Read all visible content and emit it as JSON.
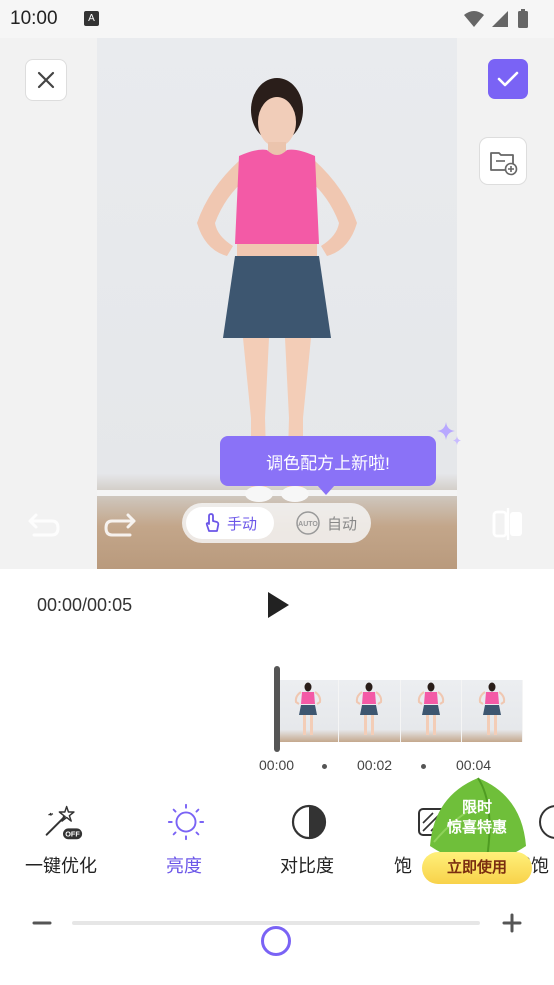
{
  "status_bar": {
    "time": "10:00",
    "notif_glyph": "A",
    "icons": [
      "wifi-icon",
      "signal-icon",
      "battery-icon"
    ]
  },
  "header": {
    "close_icon": "close-icon",
    "confirm_icon": "check-icon",
    "save_icon": "folder-add-icon"
  },
  "preview": {
    "tooltip": "调色配方上新啦!"
  },
  "mode_toggle": {
    "manual_label": "手动",
    "auto_label": "自动",
    "auto_badge": "AUTO",
    "selected": "manual"
  },
  "playback": {
    "timecode": "00:00/00:05"
  },
  "timeline": {
    "ticks": [
      "00:00",
      "00:02",
      "00:04"
    ],
    "frame_count": 4
  },
  "tools": [
    {
      "label": "一键优化",
      "icon": "magic-wand-off-icon",
      "active": false
    },
    {
      "label": "亮度",
      "icon": "brightness-icon",
      "active": true
    },
    {
      "label": "对比度",
      "icon": "contrast-icon",
      "active": false
    },
    {
      "label": "饱",
      "icon": "saturation-icon",
      "active": false
    },
    {
      "label": "然饱",
      "icon": "natural-saturation-icon",
      "active": false
    }
  ],
  "promo": {
    "line1": "限时",
    "line2": "惊喜特惠",
    "button": "立即使用"
  },
  "slider": {
    "value_fraction": 0.5
  },
  "colors": {
    "accent": "#7a63f5",
    "tooltip": "#8a72f7",
    "promo_green": "#6fbf3a",
    "promo_button": "#f8d24a"
  }
}
